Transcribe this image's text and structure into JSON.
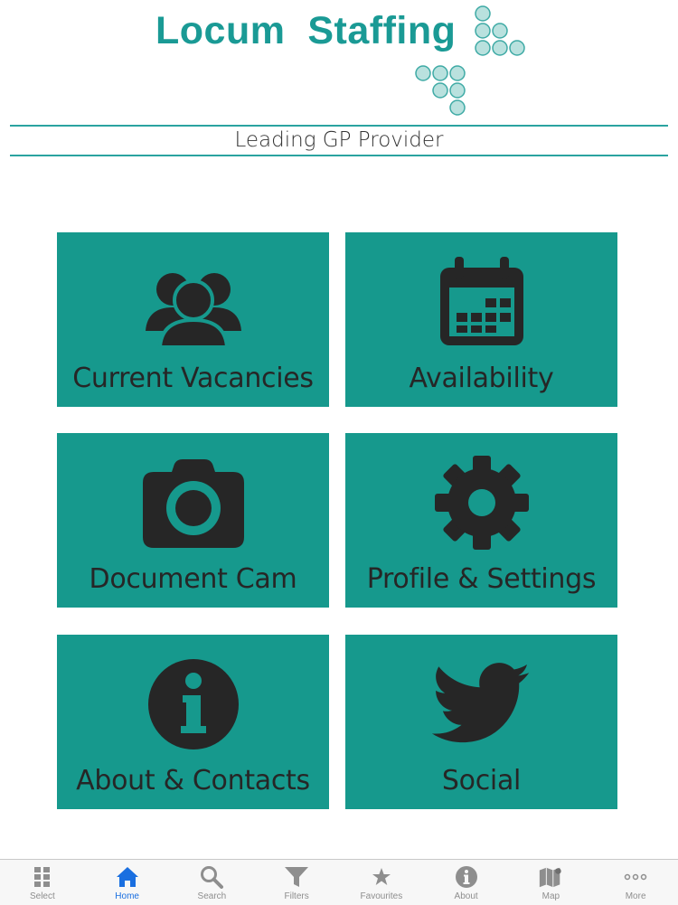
{
  "header": {
    "brand": "Locum  Staffing",
    "tagline": "Leading GP Provider"
  },
  "colors": {
    "brand": "#1a9a95",
    "tile": "#16998d",
    "icon": "#262626",
    "active_tab": "#1a6fe0",
    "inactive_tab": "#8e8e8e"
  },
  "tiles": [
    {
      "label": "Current Vacancies",
      "icon": "users-icon"
    },
    {
      "label": "Availability",
      "icon": "calendar-icon"
    },
    {
      "label": "Document Cam",
      "icon": "camera-icon"
    },
    {
      "label": "Profile & Settings",
      "icon": "gear-icon"
    },
    {
      "label": "About & Contacts",
      "icon": "info-icon"
    },
    {
      "label": "Social",
      "icon": "twitter-bird-icon"
    }
  ],
  "tabbar": {
    "active": "Home",
    "items": [
      {
        "label": "Select",
        "icon": "grid-icon"
      },
      {
        "label": "Home",
        "icon": "home-icon"
      },
      {
        "label": "Search",
        "icon": "search-icon"
      },
      {
        "label": "Filters",
        "icon": "filter-icon"
      },
      {
        "label": "Favourites",
        "icon": "star-icon"
      },
      {
        "label": "About",
        "icon": "info-icon"
      },
      {
        "label": "Map",
        "icon": "map-icon"
      },
      {
        "label": "More",
        "icon": "more-icon"
      }
    ]
  }
}
